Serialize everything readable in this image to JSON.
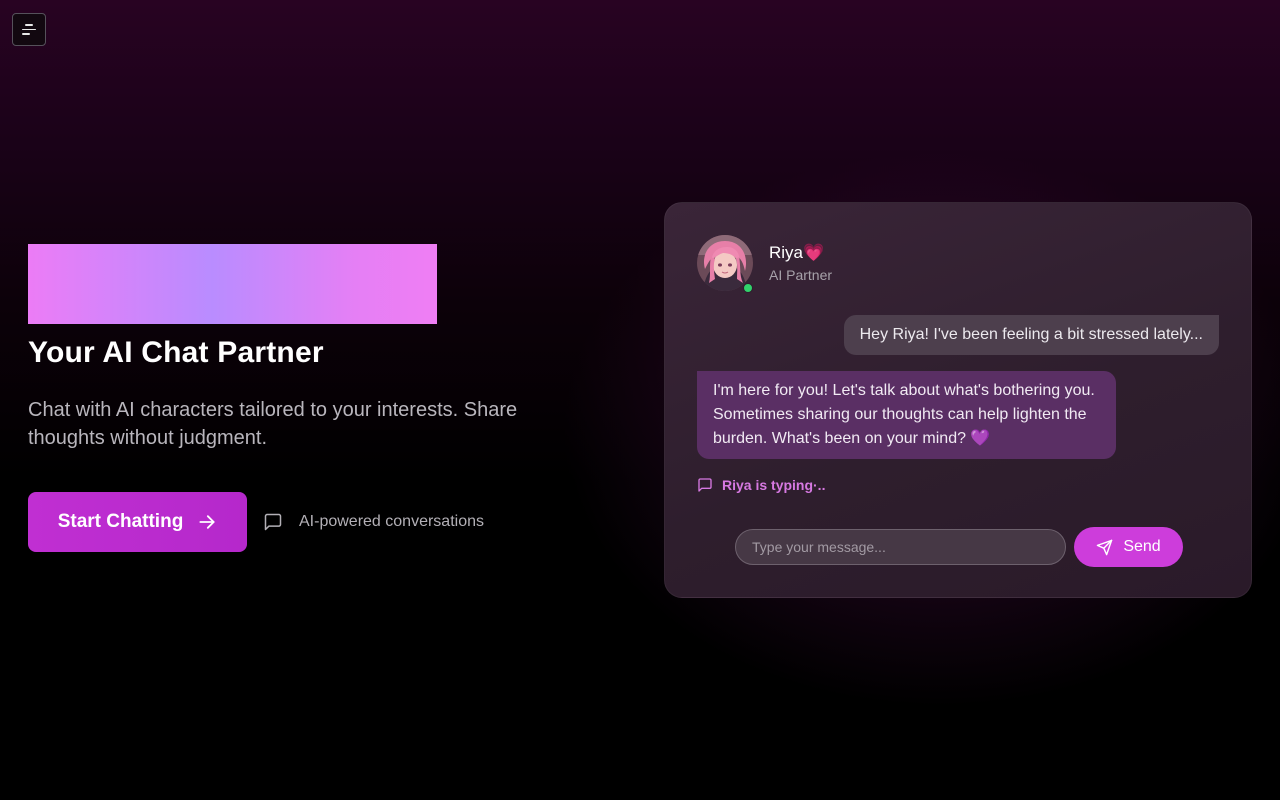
{
  "nav": {
    "menu_icon": "menu-icon"
  },
  "hero": {
    "title": "Your AI Chat Partner",
    "subtitle": "Chat with AI characters tailored to your interests. Share thoughts without judgment.",
    "cta_label": "Start Chatting",
    "cta_icon": "arrow-right-icon",
    "feature_icon": "message-square-icon",
    "feature_text": "AI-powered conversations"
  },
  "chat": {
    "character": {
      "name": "Riya💗",
      "role": "AI Partner",
      "status": "online",
      "status_color": "#31d36b"
    },
    "messages": [
      {
        "from": "user",
        "text": "Hey Riya! I've been feeling a bit stressed lately..."
      },
      {
        "from": "bot",
        "text": "I'm here for you! Let's talk about what's bothering you. Sometimes sharing our thoughts can help lighten the burden. What's been on your mind? 💜"
      }
    ],
    "typing_text": "Riya is typing·..",
    "input": {
      "placeholder": "Type your message...",
      "value": ""
    },
    "send_label": "Send",
    "send_icon": "send-icon"
  },
  "colors": {
    "accent": "#c02fd2",
    "send": "#cd3ddb",
    "typing": "#d779e2",
    "bot_bubble": "#5a2f64",
    "user_bubble": "#4d3f4d"
  }
}
